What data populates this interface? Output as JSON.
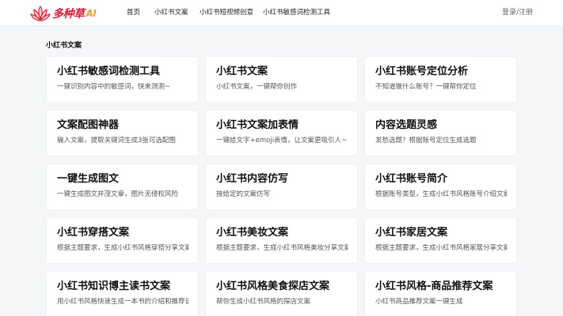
{
  "header": {
    "logo_text": "多种草",
    "logo_ai": "AI",
    "nav": [
      "首页",
      "小红书文案",
      "小红书短视频创意",
      "小红书敏感词检测工具"
    ],
    "login": "登录/注册"
  },
  "section_title": "小红书文案",
  "cards": [
    {
      "title": "小红书敏感词检测工具",
      "desc": "一键识别内容中的敏感词，快来测测~"
    },
    {
      "title": "小红书文案",
      "desc": "小红书文案，一键帮你创作"
    },
    {
      "title": "小红书账号定位分析",
      "desc": "不知道做什么账号？一键帮你定位"
    },
    {
      "title": "文案配图神器",
      "desc": "输入文案，提取关键词生成3张可选配图"
    },
    {
      "title": "小红书文案加表情",
      "desc": "一键给文字+emoji表情，让文案更吸引人~"
    },
    {
      "title": "内容选题灵感",
      "desc": "发愁选题？根据账号定位生成选题"
    },
    {
      "title": "一键生成图文",
      "desc": "一键生成图文并茂文章，图片无侵权风险"
    },
    {
      "title": "小红书内容仿写",
      "desc": "按给定的文案仿写"
    },
    {
      "title": "小红书账号简介",
      "desc": "根据账号类型，生成小红书风格账号介绍文案"
    },
    {
      "title": "小红书穿搭文案",
      "desc": "根据主题要求，生成小红书风格穿搭分享文案"
    },
    {
      "title": "小红书美妆文案",
      "desc": "根据主题要求，生成小红书风格美妆分享文案"
    },
    {
      "title": "小红书家居文案",
      "desc": "根据主题要求，生成小红书风格家居分享文案"
    },
    {
      "title": "小红书知识博主读书文案",
      "desc": "用小红书风格快速生成一本书的介绍和推荐语"
    },
    {
      "title": "小红书风格美食探店文案",
      "desc": "帮你生成小红书风格的探店文案"
    },
    {
      "title": "小红书风格-商品推荐文案",
      "desc": "小红书商品推荐文案一键生成"
    }
  ]
}
